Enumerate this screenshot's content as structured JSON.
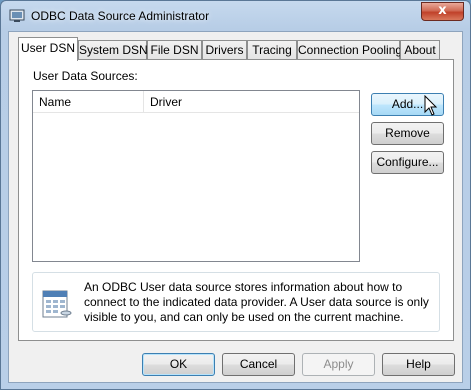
{
  "window": {
    "title": "ODBC Data Source Administrator",
    "close_glyph": "x"
  },
  "tabs": [
    {
      "label": "User DSN",
      "active": true
    },
    {
      "label": "System DSN",
      "active": false
    },
    {
      "label": "File DSN",
      "active": false
    },
    {
      "label": "Drivers",
      "active": false
    },
    {
      "label": "Tracing",
      "active": false
    },
    {
      "label": "Connection Pooling",
      "active": false
    },
    {
      "label": "About",
      "active": false
    }
  ],
  "user_dsn": {
    "list_label": "User Data Sources:",
    "columns": [
      "Name",
      "Driver"
    ],
    "rows": [],
    "buttons": {
      "add": "Add...",
      "remove": "Remove",
      "configure": "Configure..."
    },
    "info_text": "An ODBC User data source stores information about how to connect to the indicated data provider.   A User data source is only visible to you, and can only be used on the current machine."
  },
  "footer": {
    "ok": "OK",
    "cancel": "Cancel",
    "apply": "Apply",
    "help": "Help",
    "apply_enabled": false
  },
  "icons": {
    "app": "odbc-admin-icon",
    "info": "data-source-icon",
    "cursor": "mouse-pointer-icon"
  }
}
